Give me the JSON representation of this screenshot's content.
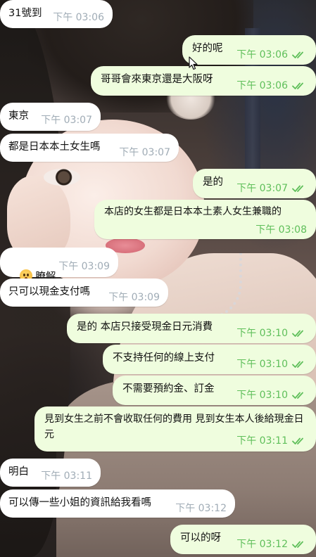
{
  "colors": {
    "incoming_bubble": "#ffffff",
    "outgoing_bubble": "#effdde",
    "incoming_time": "#a0acb6",
    "outgoing_time": "#5fbf5a"
  },
  "messages": [
    {
      "dir": "in",
      "text": "31號到",
      "time": "下午 03:06"
    },
    {
      "dir": "out",
      "text": "好的呢",
      "time": "下午 03:06",
      "status": "read"
    },
    {
      "dir": "out",
      "text": "哥哥會來東京還是大阪呀",
      "time": "下午 03:06",
      "status": "read"
    },
    {
      "dir": "in",
      "text": "東京",
      "time": "下午 03:07"
    },
    {
      "dir": "in",
      "text": "都是日本本土女生嗎",
      "time": "下午 03:07"
    },
    {
      "dir": "out",
      "text": "是的",
      "time": "下午 03:07",
      "status": "read"
    },
    {
      "dir": "out",
      "text": "本店的女生都是日本本土素人女生兼職的",
      "time": "下午 03:08",
      "status": "read"
    },
    {
      "dir": "in",
      "text": "瞭解",
      "emoji": "hushed-face-icon",
      "time": "下午 03:09"
    },
    {
      "dir": "in",
      "text": "只可以現金支付嗎",
      "time": "下午 03:09"
    },
    {
      "dir": "out",
      "text": "是的 本店只接受現金日元消費",
      "time": "下午 03:10",
      "status": "read"
    },
    {
      "dir": "out",
      "text": "不支持任何的線上支付",
      "time": "下午 03:10",
      "status": "read"
    },
    {
      "dir": "out",
      "text": "不需要預約金、訂金",
      "time": "下午 03:10",
      "status": "read"
    },
    {
      "dir": "out",
      "text": "見到女生之前不會收取任何的費用 見到女生本人後給現金日元",
      "time": "下午 03:11",
      "status": "read"
    },
    {
      "dir": "in",
      "text": "明白",
      "time": "下午 03:11"
    },
    {
      "dir": "in",
      "text": "可以傳一些小姐的資訊給我看嗎",
      "time": "下午 03:12"
    },
    {
      "dir": "out",
      "text": "可以的呀",
      "time": "下午 03:12",
      "status": "read"
    }
  ]
}
